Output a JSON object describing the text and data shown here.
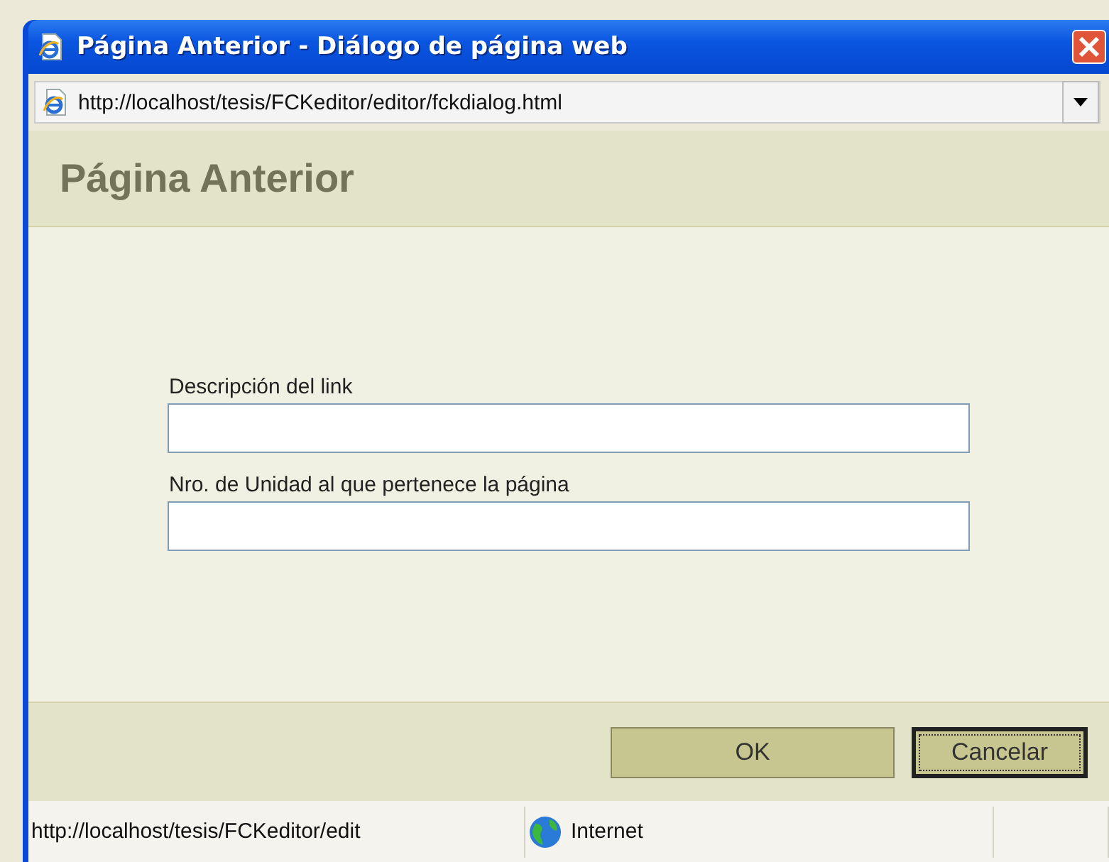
{
  "window": {
    "title": "Página Anterior - Diálogo de página web"
  },
  "address_bar": {
    "url": "http://localhost/tesis/FCKeditor/editor/fckdialog.html"
  },
  "dialog": {
    "title": "Página Anterior",
    "fields": [
      {
        "label": "Descripción del link"
      },
      {
        "label": "Nro. de Unidad al que pertenece la página"
      }
    ],
    "buttons": [
      {
        "label": "OK",
        "focused": false
      },
      {
        "label": "Cancelar",
        "focused": true
      }
    ]
  },
  "status_bar": {
    "url": "http://localhost/tesis/FCKeditor/edit",
    "zone": "Internet"
  }
}
